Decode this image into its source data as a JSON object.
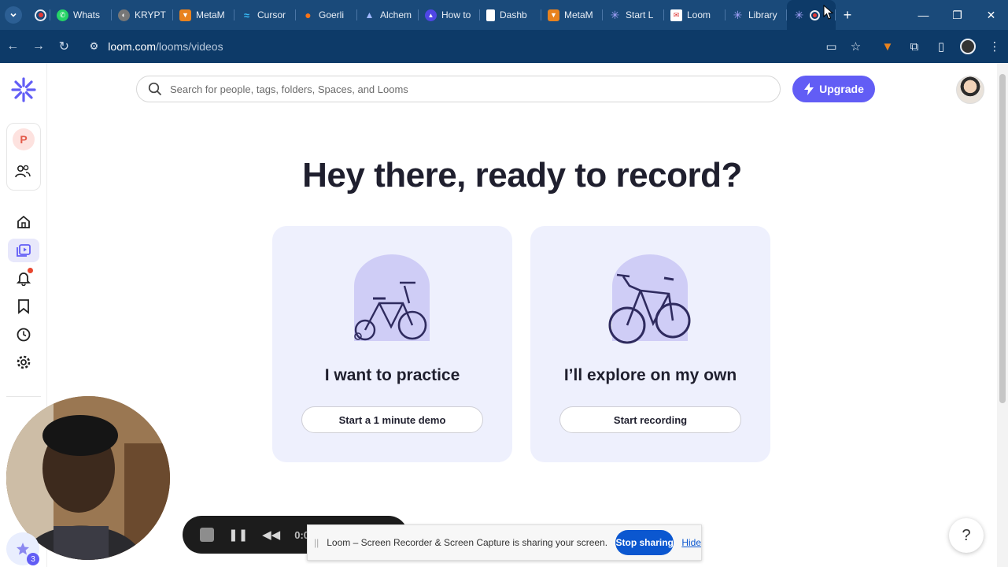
{
  "browser": {
    "tabs": [
      {
        "label": "",
        "icon": "record-dot-icon",
        "color": "#e53935"
      },
      {
        "label": "Whats",
        "icon": "whatsapp-icon",
        "color": "#25d366"
      },
      {
        "label": "KRYPT",
        "icon": "globe-icon",
        "color": "#777777"
      },
      {
        "label": "MetaM",
        "icon": "fox-icon",
        "color": "#e8821e"
      },
      {
        "label": "Cursor",
        "icon": "wave-icon",
        "color": "#38bdf8"
      },
      {
        "label": "Goerli",
        "icon": "drop-icon",
        "color": "#f97316"
      },
      {
        "label": "Alchem",
        "icon": "triangle-icon",
        "color": "#3b5bdb"
      },
      {
        "label": "How to",
        "icon": "triangle-icon",
        "color": "#4f46e5"
      },
      {
        "label": "Dashb",
        "icon": "document-icon",
        "color": "#ffffff"
      },
      {
        "label": "MetaM",
        "icon": "fox-icon",
        "color": "#e8821e"
      },
      {
        "label": "Start L",
        "icon": "loom-icon",
        "color": "#625df5"
      },
      {
        "label": "Loom",
        "icon": "mail-icon",
        "color": "#ffffff"
      },
      {
        "label": "Library",
        "icon": "loom-icon",
        "color": "#625df5"
      }
    ],
    "url_host": "loom.com",
    "url_path": "/looms/videos"
  },
  "search": {
    "placeholder": "Search for people, tags, folders, Spaces, and Looms"
  },
  "upgrade_label": "Upgrade",
  "workspace_initial": "P",
  "headline": "Hey there, ready to record?",
  "cards": [
    {
      "title": "I want to practice",
      "button": "Start a 1 minute demo"
    },
    {
      "title": "I’ll explore on my own",
      "button": "Start recording"
    }
  ],
  "recorder": {
    "time": "0:00"
  },
  "share_bar": {
    "message": "Loom – Screen Recorder & Screen Capture is sharing your screen.",
    "stop_label": "Stop sharing",
    "hide_label": "Hide"
  },
  "help_label": "?",
  "loom_badge": "3",
  "colors": {
    "brand": "#625df5",
    "card_bg": "#eef0fd",
    "browser_frame": "#0d3a68"
  }
}
